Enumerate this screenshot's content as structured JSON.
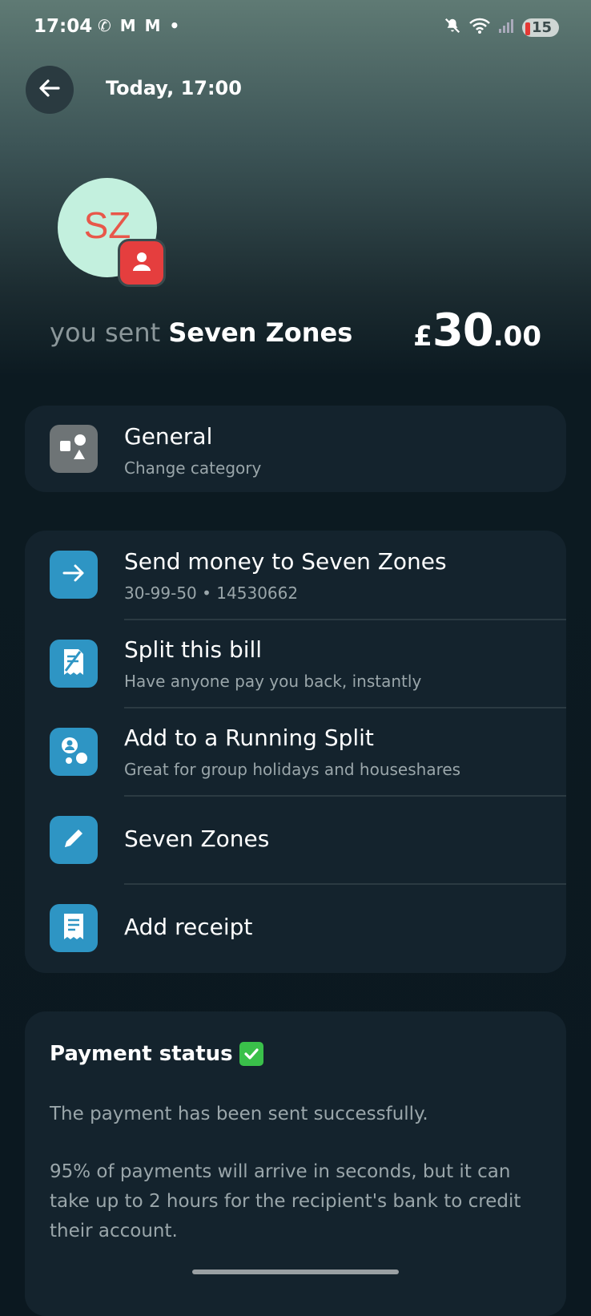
{
  "status_bar": {
    "time": "17:04",
    "left_icons": "✆ M M •",
    "battery": "15"
  },
  "header": {
    "title": "Today, 17:00"
  },
  "avatar": {
    "initials": "SZ"
  },
  "summary": {
    "prefix": "you sent",
    "name": "Seven Zones",
    "currency": "£",
    "amount_int": "30",
    "amount_dec": ".00"
  },
  "category": {
    "title": "General",
    "subtitle": "Change category"
  },
  "actions": [
    {
      "title": "Send money to Seven Zones",
      "subtitle": "30-99-50 • 14530662"
    },
    {
      "title": "Split this bill",
      "subtitle": "Have anyone pay you back, instantly"
    },
    {
      "title": "Add to a Running Split",
      "subtitle": "Great for group holidays and houseshares"
    },
    {
      "title": "Seven Zones",
      "subtitle": ""
    },
    {
      "title": "Add receipt",
      "subtitle": ""
    }
  ],
  "payment_status": {
    "title": "Payment status",
    "line1": "The payment has been sent successfully.",
    "line2": "95% of payments will arrive in seconds, but it can take up to 2 hours for the recipient's bank to credit their account."
  },
  "colors": {
    "accent_blue": "#2e95c4",
    "badge_red": "#e53e3e",
    "avatar_bg": "#c3f0de",
    "avatar_text": "#e8574a",
    "card_bg": "#14232d",
    "check_green": "#3ac04a"
  }
}
